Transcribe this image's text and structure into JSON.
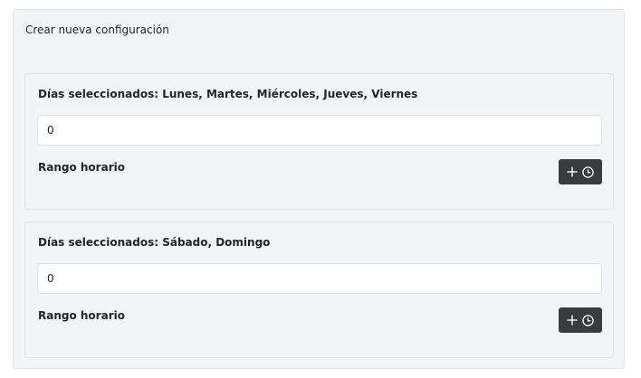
{
  "header": {
    "title": "Crear nueva configuración"
  },
  "configs": [
    {
      "days_label": "Días seleccionados: Lunes, Martes, Miércoles, Jueves, Viernes",
      "input_value": "0",
      "range_label": "Rango horario",
      "add_button_icons": [
        "plus-icon",
        "clock-icon"
      ]
    },
    {
      "days_label": "Días seleccionados: Sábado, Domingo",
      "input_value": "0",
      "range_label": "Rango horario",
      "add_button_icons": [
        "plus-icon",
        "clock-icon"
      ]
    }
  ],
  "colors": {
    "panel_background": "#f3f4f6",
    "button_background": "#3a3b3c",
    "button_icon": "#ffffff"
  }
}
